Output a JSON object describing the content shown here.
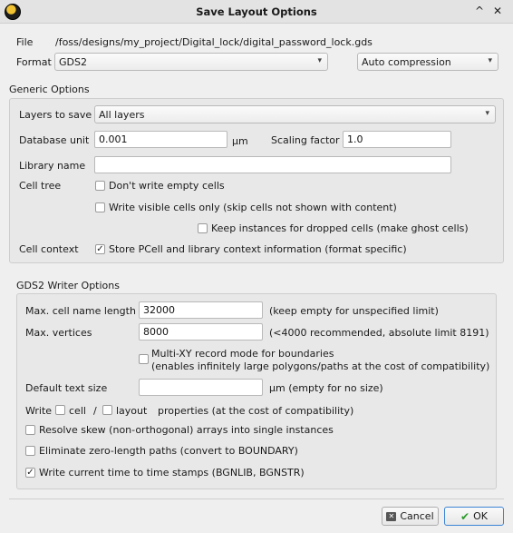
{
  "window": {
    "title": "Save Layout Options",
    "minimize": "^",
    "close": "✕"
  },
  "file": {
    "label": "File",
    "path": "/foss/designs/my_project/Digital_lock/digital_password_lock.gds"
  },
  "format": {
    "label": "Format",
    "value": "GDS2",
    "compression": "Auto compression"
  },
  "generic": {
    "title": "Generic Options",
    "layers_label": "Layers to save",
    "layers_value": "All layers",
    "db_unit_label": "Database unit",
    "db_unit_value": "0.001",
    "db_unit_suffix": "µm",
    "scaling_label": "Scaling factor",
    "scaling_value": "1.0",
    "library_label": "Library name",
    "library_value": "",
    "cell_tree_label": "Cell tree",
    "no_empty_cells": "Don't write empty cells",
    "visible_only": "Write visible cells only (skip cells not shown with content)",
    "keep_instances": "Keep instances for dropped cells (make ghost cells)",
    "cell_context_label": "Cell context",
    "store_pcell": "Store PCell and library context information (format specific)"
  },
  "gds2": {
    "title": "GDS2 Writer Options",
    "max_name_label": "Max. cell name length",
    "max_name_value": "32000",
    "max_name_hint": "(keep empty for unspecified limit)",
    "max_vert_label": "Max. vertices",
    "max_vert_value": "8000",
    "max_vert_hint": "(<4000 recommended, absolute limit 8191)",
    "multi_xy_line1": "Multi-XY record mode for boundaries",
    "multi_xy_line2": "(enables infinitely large polygons/paths at the cost of compatibility)",
    "text_size_label": "Default text size",
    "text_size_value": "",
    "text_size_hint": "µm (empty for no size)",
    "write_label": "Write",
    "cell_label": "cell",
    "slash": "/",
    "layout_label": "layout",
    "properties_label": "properties (at the cost of compatibility)",
    "resolve_skew": "Resolve skew (non-orthogonal) arrays into single instances",
    "zero_length": "Eliminate zero-length paths (convert to BOUNDARY)",
    "timestamps": "Write current time to time stamps (BGNLIB, BGNSTR)"
  },
  "buttons": {
    "cancel": "Cancel",
    "ok": "OK"
  },
  "checks": {
    "checked_glyph": "✓"
  }
}
